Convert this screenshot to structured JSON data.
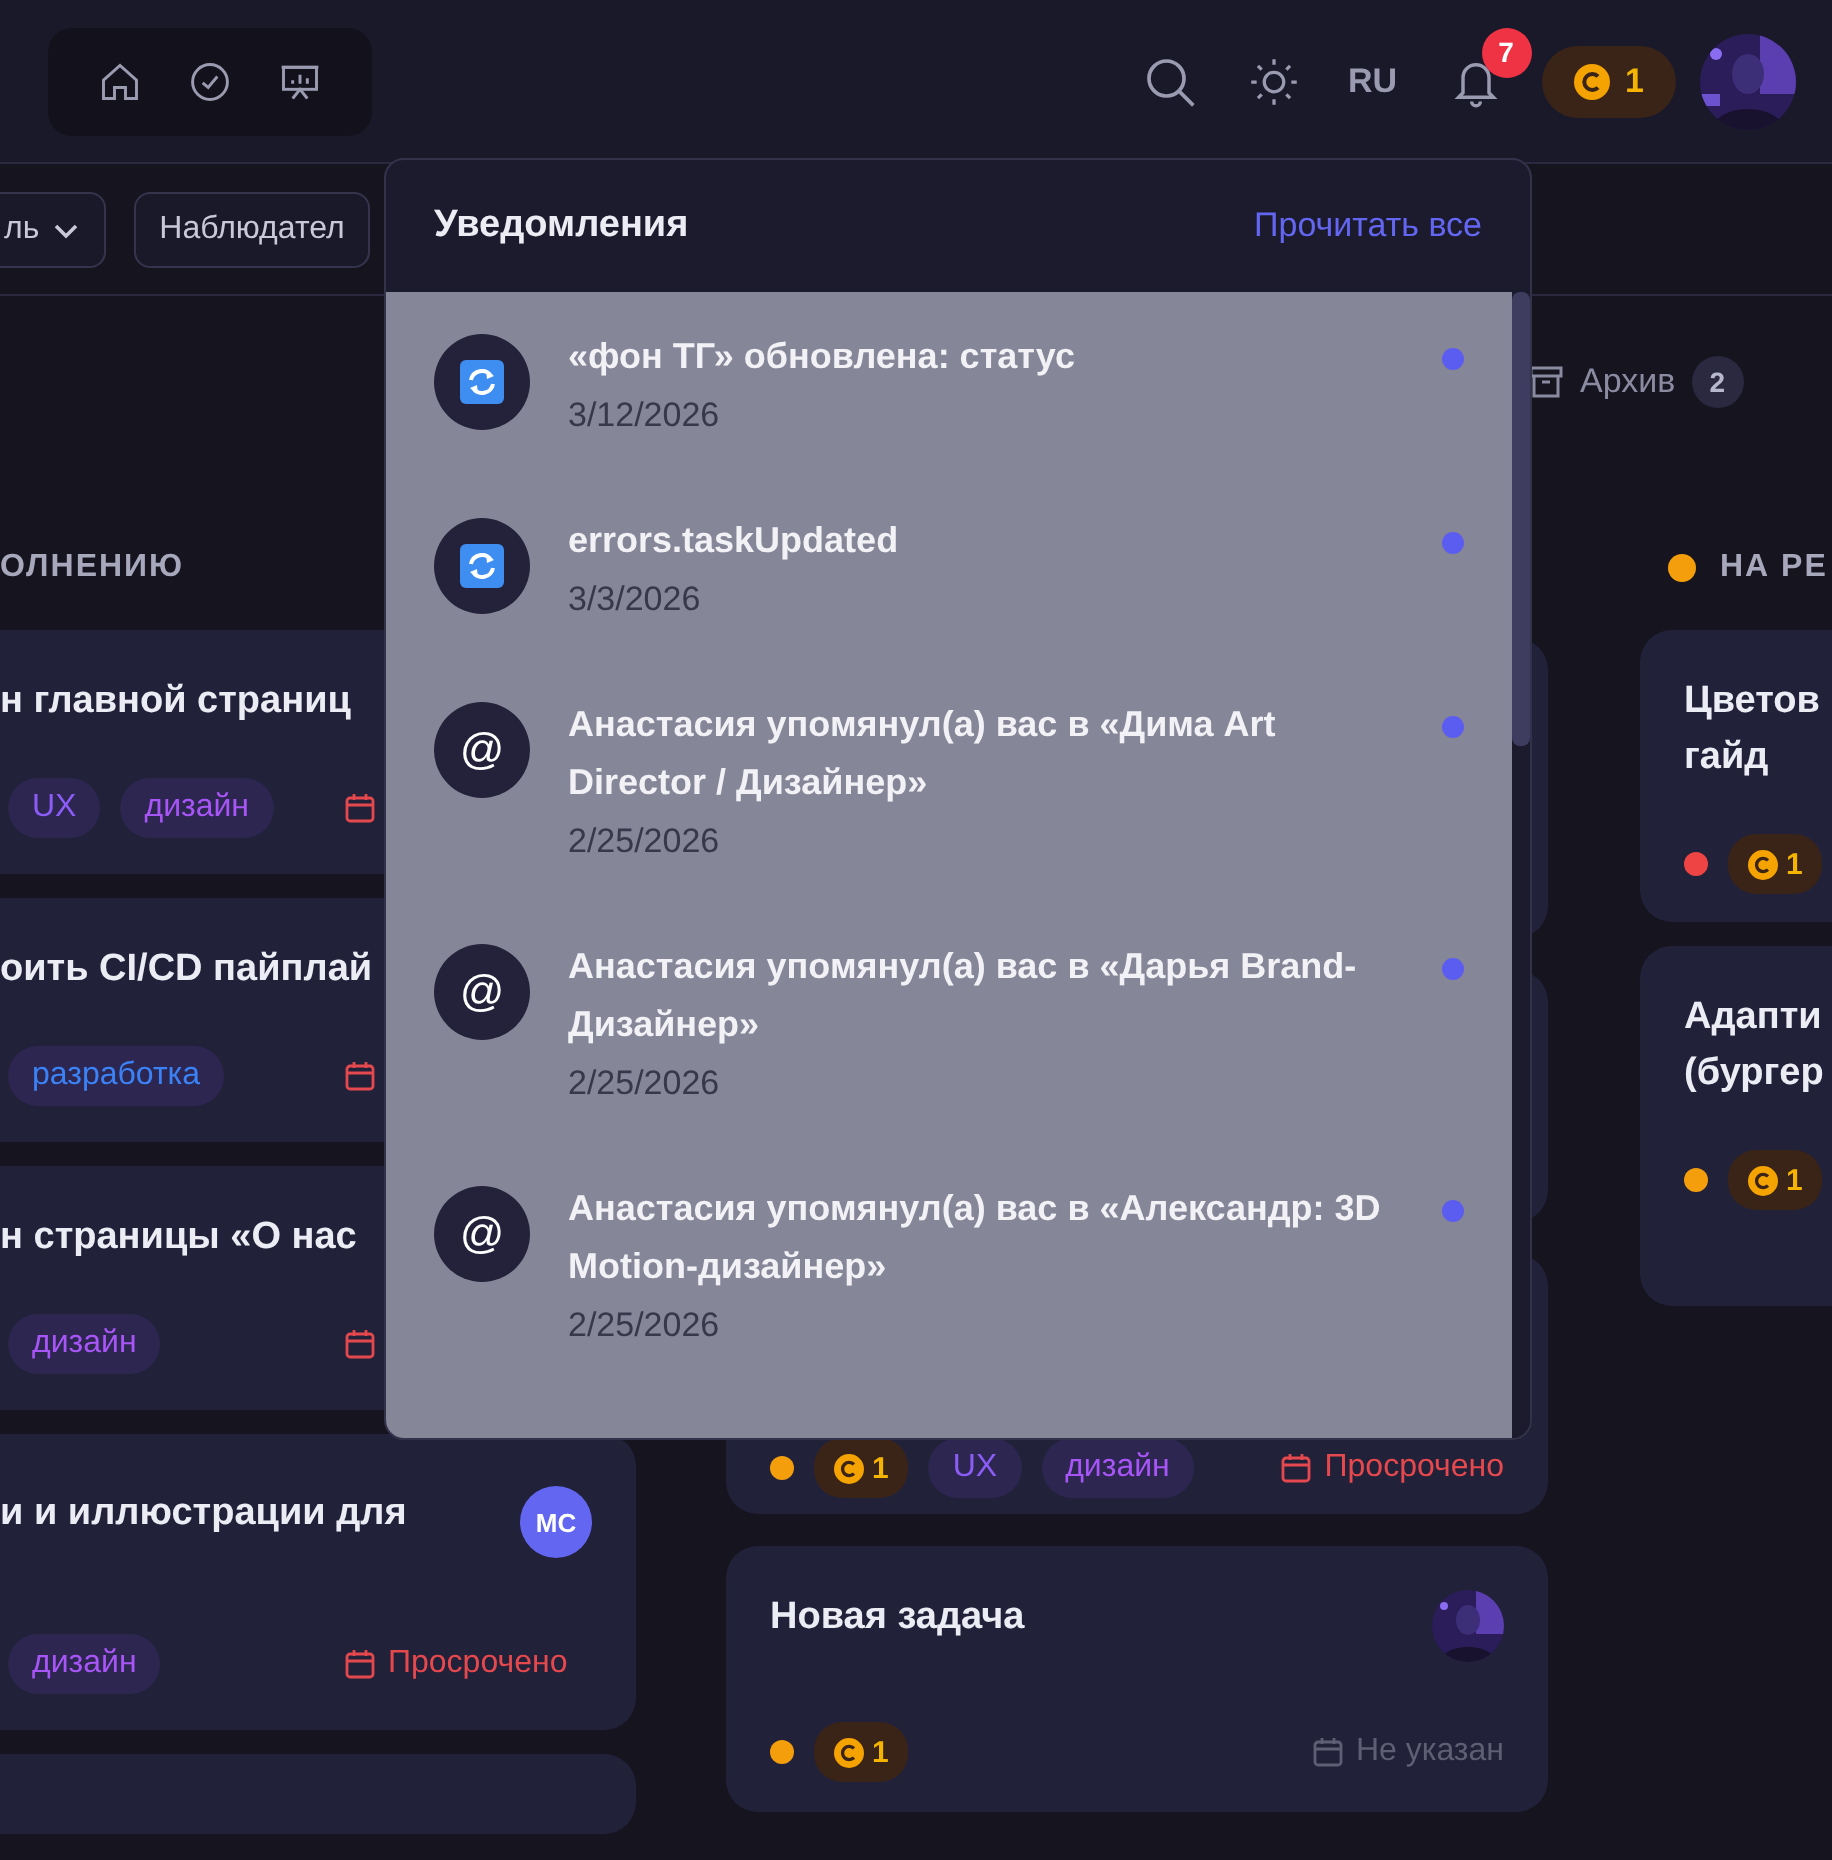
{
  "header": {
    "language": "RU",
    "notification_count": "7",
    "coins": "1"
  },
  "filters": [
    {
      "label": "ль",
      "kind": "dropdown"
    },
    {
      "label": "Наблюдател",
      "kind": "plain"
    }
  ],
  "archive": {
    "label": "Архив",
    "count": "2"
  },
  "columns": [
    {
      "title": "ОЛНЕНИЮ",
      "cards": [
        {
          "lines": [
            "н главной страниц"
          ],
          "tags": [
            {
              "label": "UX",
              "color": "#8b5cf6"
            },
            {
              "label": "дизайн",
              "color": "#a855f7"
            }
          ],
          "due": {
            "overdue": true
          }
        },
        {
          "lines": [
            "оить CI/CD пайплай"
          ],
          "tags": [
            {
              "label": "разработка",
              "color": "#3b82f6"
            }
          ],
          "due": {
            "overdue": true
          }
        },
        {
          "lines": [
            "н страницы «О нас"
          ],
          "tags": [
            {
              "label": "дизайн",
              "color": "#a855f7"
            }
          ],
          "due": {
            "overdue": true
          }
        },
        {
          "lines": [
            "и и иллюстрации для"
          ],
          "assignee": {
            "kind": "initials",
            "text": "МС"
          },
          "tags": [
            {
              "label": "дизайн",
              "color": "#a855f7"
            }
          ],
          "due": {
            "overdue": true,
            "text": "Просрочено"
          }
        }
      ]
    },
    {
      "cards": [
        {
          "color": "#f59e0b",
          "coins": "1",
          "tags": [
            {
              "label": "UX",
              "color": "#8b5cf6"
            },
            {
              "label": "дизайн",
              "color": "#a855f7"
            }
          ],
          "due": {
            "overdue": true,
            "text": "Просрочено"
          }
        },
        {
          "lines": [
            "Новая задача"
          ],
          "assignee": {
            "kind": "picture"
          },
          "color": "#f59e0b",
          "coins": "1",
          "due": {
            "overdue": false,
            "text": "Не указан"
          }
        }
      ]
    },
    {
      "title": "НА РЕ",
      "color": "#f59e0b",
      "cards": [
        {
          "lines": [
            "Цветов",
            "гайд"
          ],
          "color": "#ef4444",
          "coins": "1"
        },
        {
          "lines": [
            "Адапти",
            "(бургер"
          ],
          "color": "#f59e0b",
          "coins": "1"
        }
      ]
    }
  ],
  "notifications": {
    "title": "Уведомления",
    "action": "Прочитать все",
    "items": [
      {
        "kind": "update",
        "text": "«фон ТГ» обновлена: статус",
        "date": "3/12/2026",
        "unread": true
      },
      {
        "kind": "update",
        "text": "errors.taskUpdated",
        "date": "3/3/2026",
        "unread": true
      },
      {
        "kind": "mention",
        "symbol": "@",
        "text": "Анастасия упомянул(а) вас в «Дима Art Director / Дизайнер»",
        "date": "2/25/2026",
        "unread": true
      },
      {
        "kind": "mention",
        "symbol": "@",
        "text": "Анастасия упомянул(а) вас в «Дарья Brand-Дизайнер»",
        "date": "2/25/2026",
        "unread": true
      },
      {
        "kind": "mention",
        "symbol": "@",
        "text": "Анастасия упомянул(а) вас в «Александр: 3D Motion-дизайнер»",
        "date": "2/25/2026",
        "unread": true
      }
    ]
  }
}
